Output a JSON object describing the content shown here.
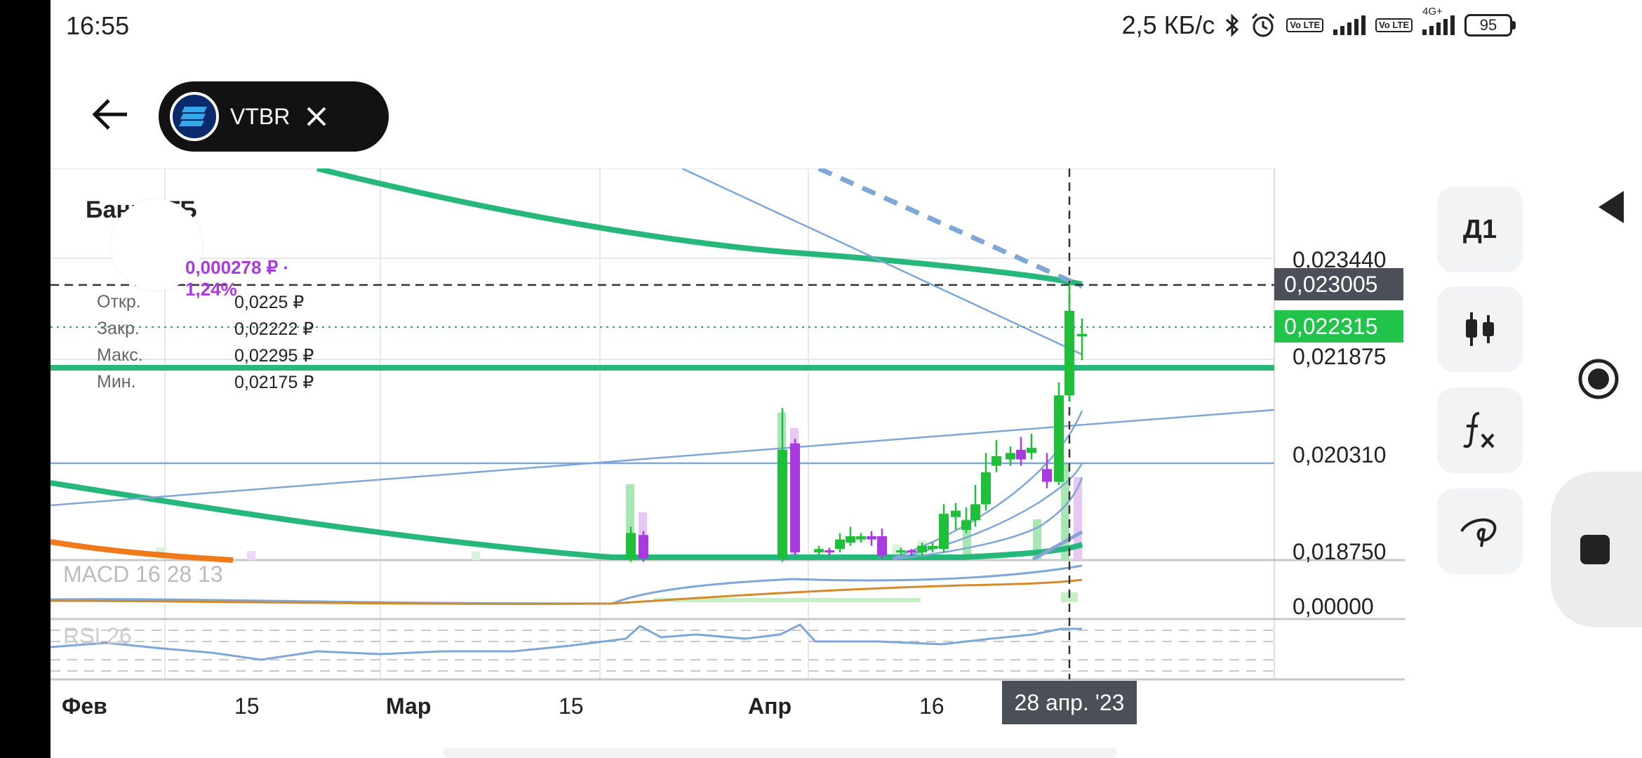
{
  "status_bar": {
    "time": "16:55",
    "network_speed": "2,5 КБ/с",
    "volte_1": "Vo LTE",
    "volte_2": "Vo LTE",
    "net_type": "4G+",
    "battery": "95",
    "icons": [
      "bluetooth-icon",
      "alarm-icon",
      "signal-icon",
      "battery-icon"
    ]
  },
  "header": {
    "ticker": "VTBR",
    "icons": [
      "back-arrow-icon",
      "vtb-logo-icon",
      "close-icon"
    ]
  },
  "legend": {
    "title": "Банк ВТБ",
    "change": "0,000278 ₽ · 1,24%",
    "rows": [
      {
        "label": "Откр.",
        "value": "0,0225 ₽"
      },
      {
        "label": "Закр.",
        "value": "0,02222 ₽"
      },
      {
        "label": "Макс.",
        "value": "0,02295 ₽"
      },
      {
        "label": "Мин.",
        "value": "0,02175 ₽"
      }
    ]
  },
  "price_axis": {
    "labels": [
      "0,023440",
      "0,021875",
      "0,020310",
      "0,018750"
    ],
    "crosshair_price": "0,023005",
    "current_price": "0,022315",
    "macd_zero": "0,00000"
  },
  "indicators": {
    "macd": "MACD 16 28 13",
    "rsi": "RSI 26"
  },
  "time_axis": {
    "labels": [
      "Фев",
      "15",
      "Мар",
      "15",
      "Апр",
      "16"
    ],
    "crosshair_date": "28 апр. '23"
  },
  "toolbar": {
    "period": "Д1",
    "icons": [
      "candlestick-icon",
      "indicators-fx-icon",
      "drawing-tool-icon"
    ]
  },
  "nav": {
    "icons": [
      "nav-back-icon",
      "nav-home-icon",
      "nav-recent-icon"
    ]
  },
  "colors": {
    "bull": "#1fbf3a",
    "bear": "#a83adf",
    "ma_green": "#25b87a",
    "ma_orange": "#f07a1a",
    "line_blue": "#7ea7d8"
  },
  "chart_data": {
    "type": "candlestick",
    "candles": [
      {
        "o": 0.01875,
        "c": 0.01915,
        "h": 0.01925,
        "l": 0.0187
      },
      {
        "o": 0.01912,
        "c": 0.01875,
        "h": 0.01918,
        "l": 0.0187
      },
      {
        "o": 0.01875,
        "c": 0.02045,
        "h": 0.0211,
        "l": 0.0187
      },
      {
        "o": 0.02055,
        "c": 0.01885,
        "h": 0.02062,
        "l": 0.0188
      },
      {
        "o": 0.01885,
        "c": 0.0189,
        "h": 0.01895,
        "l": 0.0188
      },
      {
        "o": 0.01888,
        "c": 0.01885,
        "h": 0.01892,
        "l": 0.0188
      },
      {
        "o": 0.0189,
        "c": 0.01905,
        "h": 0.01915,
        "l": 0.01885
      },
      {
        "o": 0.019,
        "c": 0.0191,
        "h": 0.01925,
        "l": 0.01895
      },
      {
        "o": 0.01905,
        "c": 0.0191,
        "h": 0.01915,
        "l": 0.019
      },
      {
        "o": 0.0191,
        "c": 0.01905,
        "h": 0.01918,
        "l": 0.01895
      },
      {
        "o": 0.0191,
        "c": 0.0188,
        "h": 0.01922,
        "l": 0.01875
      },
      {
        "o": 0.01885,
        "c": 0.01888,
        "h": 0.01892,
        "l": 0.0188
      },
      {
        "o": 0.01888,
        "c": 0.01885,
        "h": 0.0189,
        "l": 0.0188
      },
      {
        "o": 0.01885,
        "c": 0.01895,
        "h": 0.019,
        "l": 0.0188
      },
      {
        "o": 0.0189,
        "c": 0.01895,
        "h": 0.019,
        "l": 0.01885
      },
      {
        "o": 0.0189,
        "c": 0.01945,
        "h": 0.0196,
        "l": 0.01885
      },
      {
        "o": 0.0194,
        "c": 0.0195,
        "h": 0.01962,
        "l": 0.0192
      },
      {
        "o": 0.0192,
        "c": 0.01935,
        "h": 0.01955,
        "l": 0.01915
      },
      {
        "o": 0.01935,
        "c": 0.0196,
        "h": 0.0199,
        "l": 0.01925
      },
      {
        "o": 0.0196,
        "c": 0.0201,
        "h": 0.0204,
        "l": 0.0195
      },
      {
        "o": 0.0202,
        "c": 0.02035,
        "h": 0.0206,
        "l": 0.0201
      },
      {
        "o": 0.0203,
        "c": 0.0204,
        "h": 0.0205,
        "l": 0.0202
      },
      {
        "o": 0.02045,
        "c": 0.0203,
        "h": 0.02065,
        "l": 0.0202
      },
      {
        "o": 0.0204,
        "c": 0.02048,
        "h": 0.0207,
        "l": 0.0203
      },
      {
        "o": 0.02015,
        "c": 0.01995,
        "h": 0.0204,
        "l": 0.01985
      },
      {
        "o": 0.01995,
        "c": 0.0213,
        "h": 0.0215,
        "l": 0.0199
      },
      {
        "o": 0.0213,
        "c": 0.02262,
        "h": 0.02305,
        "l": 0.0212
      },
      {
        "o": 0.0225,
        "c": 0.02222,
        "h": 0.02295,
        "l": 0.02175
      },
      {
        "o": 0.02222,
        "c": 0.02226,
        "h": 0.0225,
        "l": 0.02185
      }
    ]
  }
}
